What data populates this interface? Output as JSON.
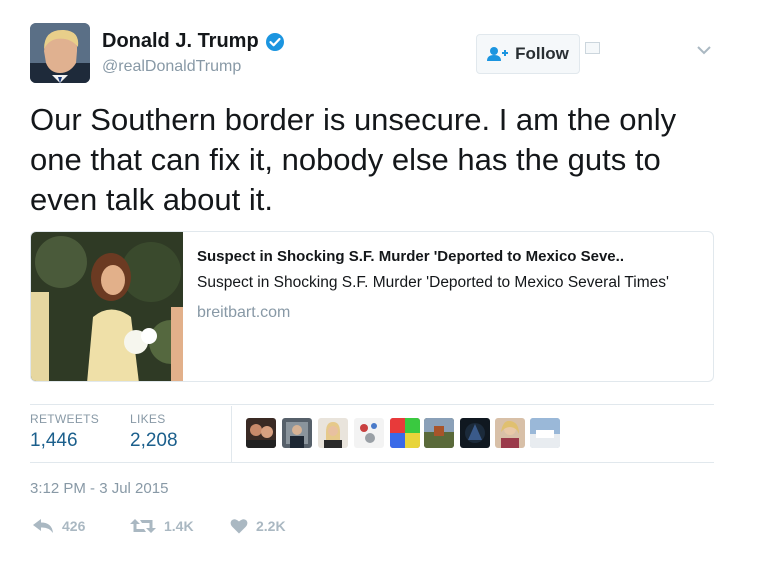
{
  "tweet": {
    "author": {
      "name": "Donald J. Trump",
      "handle": "@realDonaldTrump",
      "verified": true
    },
    "follow_label": "Follow",
    "text": "Our Southern border is unsecure. I am the only one that can fix it, nobody else has the guts to even talk about it.",
    "card": {
      "title": "Suspect in Shocking S.F. Murder 'Deported to Mexico Seve..",
      "description": "Suspect in Shocking S.F. Murder 'Deported to Mexico Several Times'",
      "domain": "breitbart.com"
    },
    "stats": {
      "retweets_label": "RETWEETS",
      "retweets_value": "1,446",
      "likes_label": "LIKES",
      "likes_value": "2,208"
    },
    "timestamp": "3:12 PM - 3 Jul 2015",
    "actions": {
      "reply_count": "426",
      "retweet_count": "1.4K",
      "like_count": "2.2K"
    }
  },
  "colors": {
    "link_blue": "#1b95e0",
    "stat_blue": "#1b5f8c",
    "muted_gray": "#8899a6",
    "action_gray": "#aab8c2",
    "border": "#e1e8ed"
  },
  "icons": {
    "verified": "verified-badge-icon",
    "follow": "add-user-icon",
    "caret": "chevron-down-icon",
    "reply": "reply-icon",
    "retweet": "retweet-icon",
    "like": "heart-icon"
  }
}
